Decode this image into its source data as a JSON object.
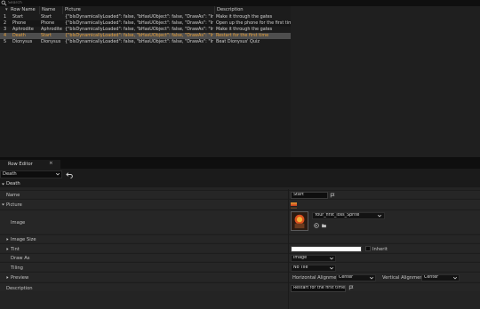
{
  "search": {
    "placeholder": "Search"
  },
  "table": {
    "columns": [
      "",
      "Row Name",
      "Name",
      "Picture",
      "Description"
    ],
    "rows": [
      {
        "index": "1",
        "row_name": "Start",
        "name": "Start",
        "picture": "{\"bIsDynamicallyLoaded\": false, \"bHasUObject\": false, \"DrawAs\": \"Image\",",
        "description": "Make it through the gates",
        "selected": false
      },
      {
        "index": "2",
        "row_name": "Phone",
        "name": "Phone",
        "picture": "{\"bIsDynamicallyLoaded\": false, \"bHasUObject\": false, \"DrawAs\": \"Image\",",
        "description": "Open up the phone for the first time",
        "selected": false
      },
      {
        "index": "3",
        "row_name": "Aphrodite",
        "name": "Aphrodite",
        "picture": "{\"bIsDynamicallyLoaded\": false, \"bHasUObject\": false, \"DrawAs\": \"Image\",",
        "description": "Make it through the gates",
        "selected": false
      },
      {
        "index": "4",
        "row_name": "Death",
        "name": "Start",
        "picture": "{\"bIsDynamicallyLoaded\": false, \"bHasUObject\": false, \"DrawAs\": \"Image\",",
        "description": "Restart for the first time",
        "selected": true
      },
      {
        "index": "5",
        "row_name": "Dionysus",
        "name": "Dionysus",
        "picture": "{\"bIsDynamicallyLoaded\": false, \"bHasUObject\": false, \"DrawAs\": \"Image\",",
        "description": "Beat Dionysus' Quiz",
        "selected": false
      }
    ]
  },
  "editor": {
    "tab_label": "Row Editor",
    "tab_close": "×",
    "current_row": "Death",
    "category": "Death",
    "props": {
      "name_label": "Name",
      "name_value": "Start",
      "picture_label": "Picture",
      "image_label": "Image",
      "image_asset": "Your_first_loss_Sprite",
      "image_size_label": "Image Size",
      "tint_label": "Tint",
      "inherit_label": "Inherit",
      "draw_as_label": "Draw As",
      "draw_as_value": "Image",
      "tiling_label": "Tiling",
      "tiling_value": "No Tile",
      "preview_label": "Preview",
      "halign_label": "Horizontal Alignment",
      "halign_value": "Center",
      "valign_label": "Vertical Alignment",
      "valign_value": "Center",
      "description_label": "Description",
      "description_value": "Restart for the first time"
    }
  },
  "colors": {
    "selected_row_text": "#eaa23a",
    "selected_row_bg": "#4e4e4e",
    "panel_bg": "#242424"
  },
  "icons": [
    "search-icon",
    "chevron-down-icon",
    "back-arrow-icon",
    "flag-icon",
    "folder-icon",
    "arrow-left-icon",
    "expand-caret-icon",
    "color-swatch-icon"
  ]
}
